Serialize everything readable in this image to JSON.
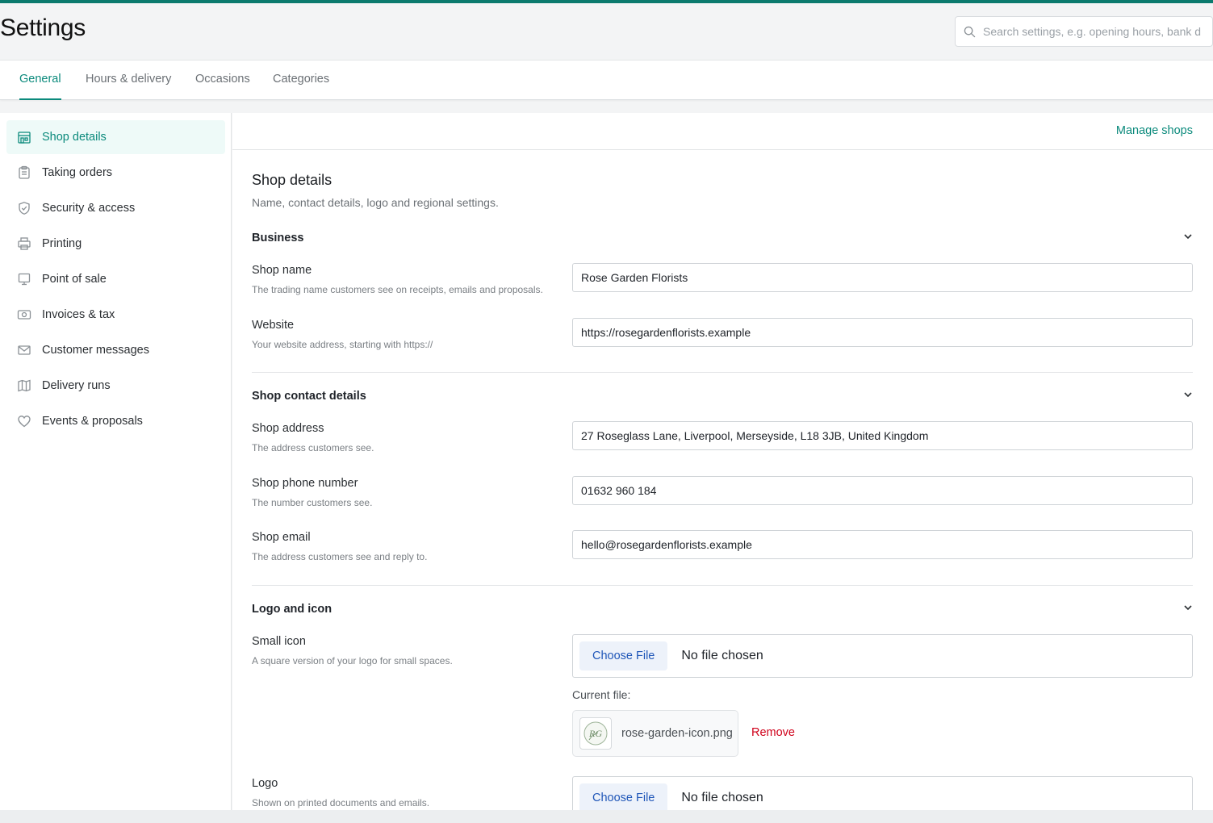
{
  "header": {
    "title": "Settings",
    "search_placeholder": "Search settings, e.g. opening hours, bank d"
  },
  "tabs": [
    {
      "label": "General",
      "active": true
    },
    {
      "label": "Hours & delivery"
    },
    {
      "label": "Occasions"
    },
    {
      "label": "Categories"
    }
  ],
  "sidebar": {
    "items": [
      {
        "label": "Shop details",
        "icon": "shop-icon",
        "active": true
      },
      {
        "label": "Taking orders",
        "icon": "clipboard-icon"
      },
      {
        "label": "Security & access",
        "icon": "shield-icon"
      },
      {
        "label": "Printing",
        "icon": "printer-icon"
      },
      {
        "label": "Point of sale",
        "icon": "monitor-icon"
      },
      {
        "label": "Invoices & tax",
        "icon": "invoice-icon"
      },
      {
        "label": "Customer messages",
        "icon": "mail-icon"
      },
      {
        "label": "Delivery runs",
        "icon": "map-icon"
      },
      {
        "label": "Events & proposals",
        "icon": "heart-icon"
      }
    ]
  },
  "main": {
    "manage_link": "Manage shops",
    "title": "Shop details",
    "description": "Name, contact details, logo and regional settings.",
    "business": {
      "title": "Business",
      "shop_name": {
        "label": "Shop name",
        "help": "The trading name customers see on receipts, emails and proposals.",
        "value": "Rose Garden Florists"
      },
      "website": {
        "label": "Website",
        "help": "Your website address, starting with https://",
        "value": "https://rosegardenflorists.example"
      }
    },
    "contact": {
      "title": "Shop contact details",
      "address": {
        "label": "Shop address",
        "help": "The address customers see.",
        "value": "27 Roseglass Lane, Liverpool, Merseyside, L18 3JB, United Kingdom"
      },
      "phone": {
        "label": "Shop phone number",
        "help": "The number customers see.",
        "value": "01632 960 184"
      },
      "email": {
        "label": "Shop email",
        "help": "The address customers see and reply to.",
        "value": "hello@rosegardenflorists.example"
      }
    },
    "logo": {
      "title": "Logo and icon",
      "small_icon": {
        "label": "Small icon",
        "help": "A square version of your logo for small spaces.",
        "choose_label": "Choose File",
        "no_file": "No file chosen",
        "current_label": "Current file:",
        "current_file": "rose-garden-icon.png",
        "remove_label": "Remove",
        "thumb_text": "RG"
      },
      "logo": {
        "label": "Logo",
        "help": "Shown on printed documents and emails.",
        "choose_label": "Choose File",
        "no_file": "No file chosen"
      }
    }
  },
  "colors": {
    "accent": "#0b8a7c",
    "topbar": "#0b7a6e",
    "danger": "#d0021b",
    "file_button_text": "#1f56b8"
  }
}
